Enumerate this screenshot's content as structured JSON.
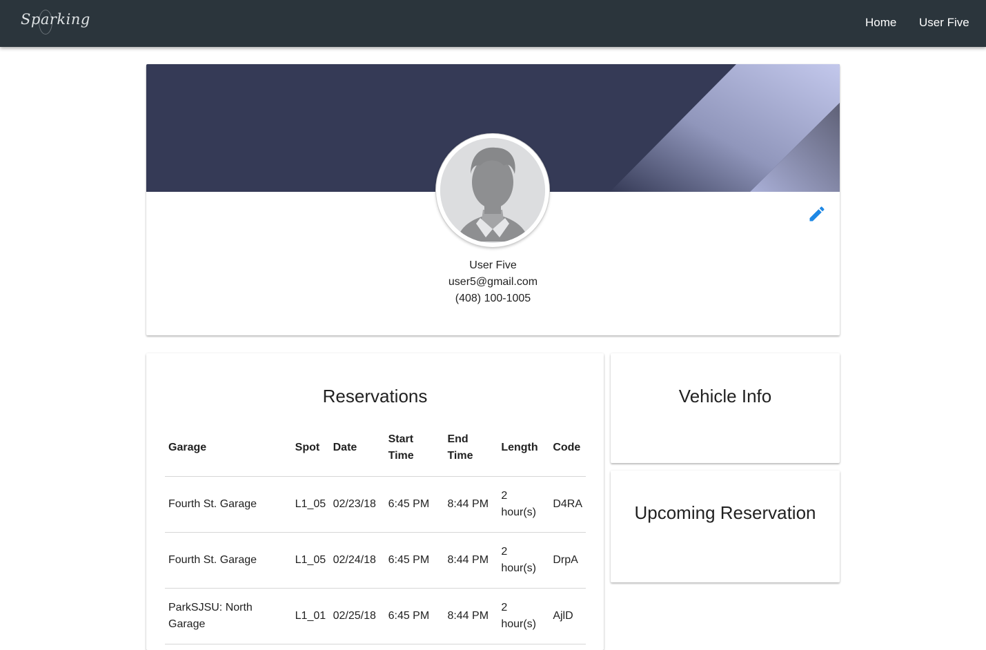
{
  "navbar": {
    "brand": "Sparking",
    "links": [
      "Home",
      "User Five"
    ]
  },
  "profile": {
    "name": "User Five",
    "email": "user5@gmail.com",
    "phone": "(408) 100-1005",
    "edit_icon": "pencil-icon",
    "banner_colors": {
      "base": "#353a56",
      "light": "#b9bfe4",
      "mid": "#7c80a0"
    },
    "accent": "#1e88e5"
  },
  "reservations": {
    "title": "Reservations",
    "columns": [
      {
        "line1": "Garage",
        "line2": ""
      },
      {
        "line1": "Spot",
        "line2": ""
      },
      {
        "line1": "Date",
        "line2": ""
      },
      {
        "line1": "Start",
        "line2": "Time"
      },
      {
        "line1": "End",
        "line2": "Time"
      },
      {
        "line1": "Length",
        "line2": ""
      },
      {
        "line1": "Code",
        "line2": ""
      }
    ],
    "rows": [
      {
        "garage": [
          "Fourth St. Garage",
          ""
        ],
        "spot": "L1_05",
        "date": "02/23/18",
        "start": "6:45 PM",
        "end": "8:44 PM",
        "length": [
          "2",
          "hour(s)"
        ],
        "code": "D4RA"
      },
      {
        "garage": [
          "Fourth St. Garage",
          ""
        ],
        "spot": "L1_05",
        "date": "02/24/18",
        "start": "6:45 PM",
        "end": "8:44 PM",
        "length": [
          "2",
          "hour(s)"
        ],
        "code": "DrpA"
      },
      {
        "garage": [
          "ParkSJSU: North",
          "Garage"
        ],
        "spot": "L1_01",
        "date": "02/25/18",
        "start": "6:45 PM",
        "end": "8:44 PM",
        "length": [
          "2",
          "hour(s)"
        ],
        "code": "AjlD"
      }
    ]
  },
  "vehicle_info": {
    "title": "Vehicle Info"
  },
  "upcoming": {
    "title": "Upcoming Reservation"
  }
}
